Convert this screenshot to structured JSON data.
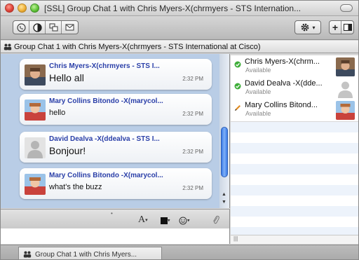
{
  "window": {
    "title": "[SSL] Group Chat 1 with Chris Myers-X(chrmyers - STS Internation..."
  },
  "toolbar": {
    "buttons": [
      "phone-icon",
      "contrast-icon",
      "window-icon",
      "mail-icon"
    ],
    "gear_caret": "▾",
    "add_label": "+"
  },
  "header": {
    "title": "Group Chat 1 with Chris Myers-X(chrmyers - STS International at Cisco)"
  },
  "messages": [
    {
      "sender": "Chris Myers-X(chrmyers - STS I...",
      "text": "Hello all",
      "time": "2:32 PM",
      "size": "big"
    },
    {
      "sender": "Mary Collins Bitondo -X(marycol...",
      "text": "hello",
      "time": "2:32 PM",
      "size": "small"
    },
    {
      "sender": "David Dealva -X(ddealva - STS I...",
      "text": "Bonjour!",
      "time": "2:32 PM",
      "size": "big"
    },
    {
      "sender": "Mary Collins Bitondo -X(marycol...",
      "text": "what's the buzz",
      "time": "2:32 PM",
      "size": "small"
    }
  ],
  "compose": {
    "font_label": "A",
    "caret": "▾"
  },
  "roster": [
    {
      "name": "Chris Myers-X(chrm...",
      "status": "Available",
      "status_icon": "available-icon"
    },
    {
      "name": "David Dealva -X(dde...",
      "status": "Available",
      "status_icon": "available-icon"
    },
    {
      "name": "Mary Collins Bitond...",
      "status": "Available",
      "status_icon": "typing-icon"
    }
  ],
  "roster_footer": "|||",
  "tabs": [
    {
      "label": "Group Chat 1 with Chris Myers..."
    }
  ],
  "colors": {
    "chat_background": "#b9cde6",
    "sender_name": "#2a3fa8",
    "available": "#3fae3a",
    "scroll_thumb": "#3a7be8"
  }
}
